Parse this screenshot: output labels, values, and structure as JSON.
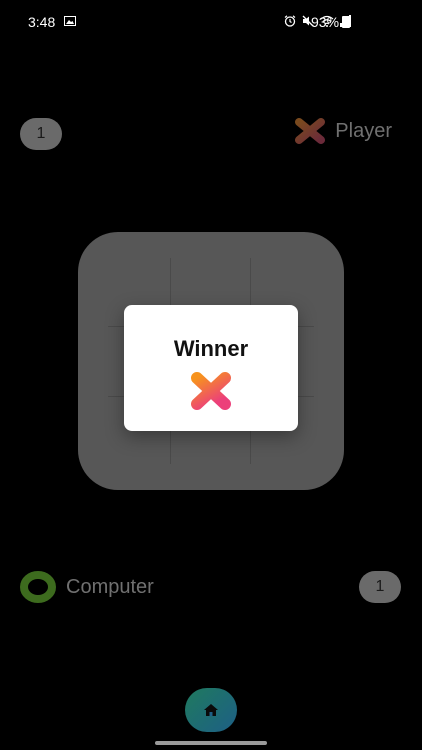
{
  "status_bar": {
    "time": "3:48",
    "battery_percent": "93%",
    "icons": [
      "gallery-icon",
      "alarm-icon",
      "mute-icon",
      "wifi-icon",
      "signal-icon",
      "battery-icon"
    ]
  },
  "scoreboard": {
    "player": {
      "label": "Player",
      "score": "1",
      "mark": "x-mark-icon"
    },
    "computer": {
      "label": "Computer",
      "score": "1",
      "mark": "o-mark-icon"
    }
  },
  "modal": {
    "title": "Winner",
    "winner_mark": "x-mark-icon"
  },
  "nav": {
    "home_icon": "home-icon"
  },
  "colors": {
    "background": "#000000",
    "board": "#575757",
    "x_gradient_start": "#f7931e",
    "x_gradient_end": "#ec407a",
    "o_mark": "#3d6b1e",
    "home_gradient_start": "#1f7a5e",
    "home_gradient_end": "#1e5f86"
  }
}
